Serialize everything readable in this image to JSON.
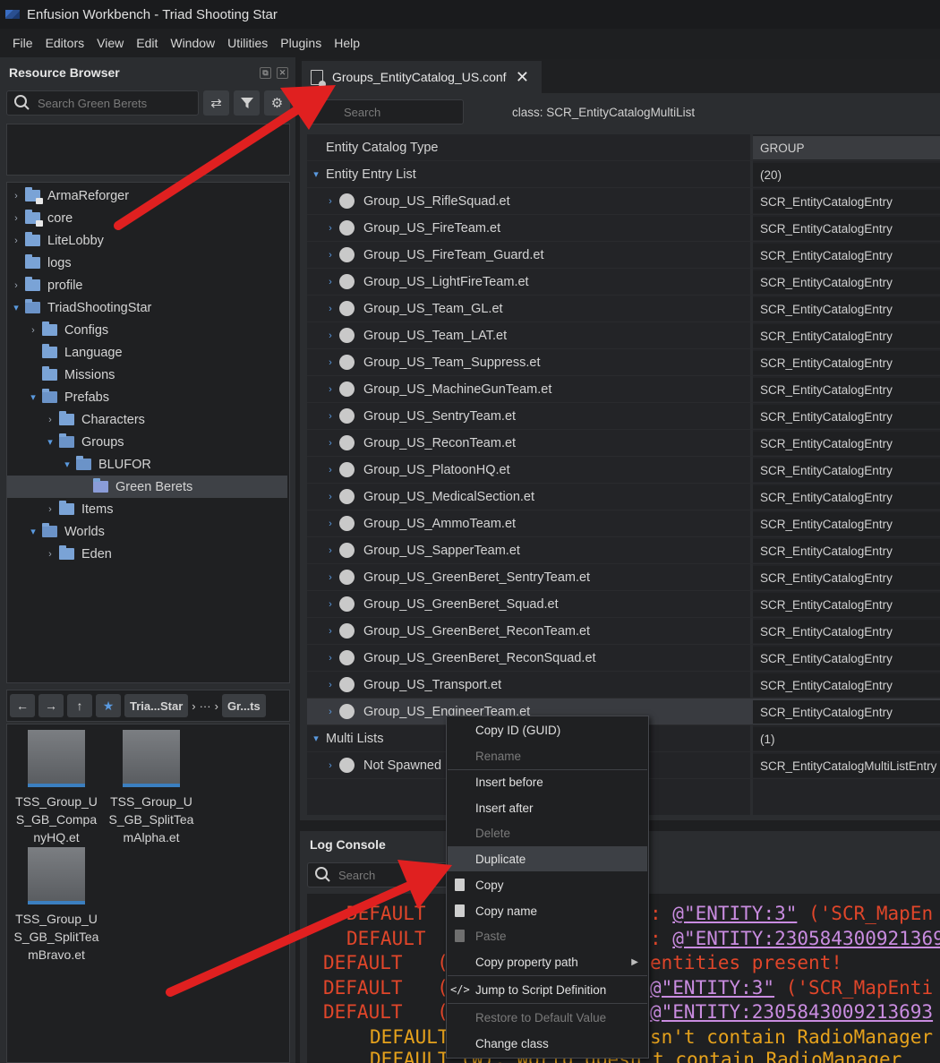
{
  "window": {
    "title": "Enfusion Workbench - Triad Shooting Star"
  },
  "menu": [
    "File",
    "Editors",
    "View",
    "Edit",
    "Window",
    "Utilities",
    "Plugins",
    "Help"
  ],
  "resource_browser": {
    "title": "Resource Browser",
    "search_placeholder": "Search Green Berets",
    "tree": [
      {
        "label": "ArmaReforger",
        "expandable": true,
        "locked": true,
        "depth": 0
      },
      {
        "label": "core",
        "expandable": true,
        "locked": true,
        "depth": 0
      },
      {
        "label": "LiteLobby",
        "expandable": true,
        "depth": 0
      },
      {
        "label": "logs",
        "expandable": false,
        "depth": 0
      },
      {
        "label": "profile",
        "expandable": true,
        "depth": 0
      },
      {
        "label": "TriadShootingStar",
        "expanded": true,
        "depth": 0
      },
      {
        "label": "Configs",
        "expandable": true,
        "depth": 1
      },
      {
        "label": "Language",
        "expandable": false,
        "depth": 1
      },
      {
        "label": "Missions",
        "expandable": false,
        "depth": 1
      },
      {
        "label": "Prefabs",
        "expanded": true,
        "depth": 1
      },
      {
        "label": "Characters",
        "expandable": true,
        "depth": 2
      },
      {
        "label": "Groups",
        "expanded": true,
        "depth": 2
      },
      {
        "label": "BLUFOR",
        "expanded": true,
        "depth": 3
      },
      {
        "label": "Green Berets",
        "selected": true,
        "depth": 4
      },
      {
        "label": "Items",
        "expandable": true,
        "depth": 2
      },
      {
        "label": "Worlds",
        "expanded": true,
        "depth": 1
      },
      {
        "label": "Eden",
        "expandable": true,
        "depth": 2
      }
    ],
    "nav": {
      "crumb1": "Tria...Star",
      "ellipsis": "···",
      "crumb2": "Gr...ts"
    },
    "files": [
      "TSS_Group_US_GB_CompanyHQ.et",
      "TSS_Group_US_GB_SplitTeamAlpha.et",
      "TSS_Group_US_GB_SplitTeamBravo.et"
    ],
    "file_lines": [
      [
        "TSS_Group_U",
        "S_GB_Compa",
        "nyHQ.et"
      ],
      [
        "TSS_Group_U",
        "S_GB_SplitTea",
        "mAlpha.et"
      ],
      [
        "TSS_Group_U",
        "S_GB_SplitTea",
        "mBravo.et"
      ]
    ]
  },
  "editor": {
    "tab_label": "Groups_EntityCatalog_US.conf",
    "search_placeholder": "Search",
    "class_label": "class: SCR_EntityCatalogMultiList",
    "catalog_type_label": "Entity Catalog Type",
    "catalog_type_value": "GROUP",
    "entry_list_label": "Entity Entry List",
    "entry_list_count": "(20)",
    "entries": [
      "Group_US_RifleSquad.et",
      "Group_US_FireTeam.et",
      "Group_US_FireTeam_Guard.et",
      "Group_US_LightFireTeam.et",
      "Group_US_Team_GL.et",
      "Group_US_Team_LAT.et",
      "Group_US_Team_Suppress.et",
      "Group_US_MachineGunTeam.et",
      "Group_US_SentryTeam.et",
      "Group_US_ReconTeam.et",
      "Group_US_PlatoonHQ.et",
      "Group_US_MedicalSection.et",
      "Group_US_AmmoTeam.et",
      "Group_US_SapperTeam.et",
      "Group_US_GreenBeret_SentryTeam.et",
      "Group_US_GreenBeret_Squad.et",
      "Group_US_GreenBeret_ReconTeam.et",
      "Group_US_GreenBeret_ReconSquad.et",
      "Group_US_Transport.et",
      "Group_US_EngineerTeam.et"
    ],
    "entry_class": "SCR_EntityCatalogEntry",
    "multi_lists_label": "Multi Lists",
    "multi_lists_count": "(1)",
    "not_spawned_label": "Not Spawned",
    "not_spawned_class": "SCR_EntityCatalogMultiListEntry"
  },
  "log_console": {
    "title": "Log Console",
    "search_placeholder": "Search",
    "lines": [
      {
        "a": "DEFAULT",
        "b": ": ",
        "c": "@\"ENTITY:3\"",
        "d": " ('SCR_MapEn"
      },
      {
        "a": "DEFAULT",
        "b": ": ",
        "c": "@\"ENTITY:230584300921369",
        "d": ""
      },
      {
        "a": "DEFAULT",
        "b": "(",
        "c": "",
        "d": "entities present!"
      },
      {
        "a": "DEFAULT",
        "b": "(",
        "c": "@\"ENTITY:3\"",
        "d": " ('SCR_MapEnti"
      },
      {
        "a": "DEFAULT",
        "b": "(",
        "c": "@\"ENTITY:2305843009213693",
        "d": ""
      },
      {
        "a": "DEFAULT",
        "b": "",
        "c": "",
        "d": "sn't contain RadioManager"
      },
      {
        "a": "DEFAULT",
        "b": "(W): World doesn't contain RadioManager",
        "c": "",
        "d": ""
      }
    ]
  },
  "context_menu": {
    "items": [
      {
        "label": "Copy ID (GUID)",
        "disabled": false
      },
      {
        "label": "Rename",
        "disabled": true
      },
      {
        "label": "Insert before",
        "disabled": false
      },
      {
        "label": "Insert after",
        "disabled": false
      },
      {
        "label": "Delete",
        "disabled": true
      },
      {
        "label": "Duplicate",
        "disabled": false,
        "hover": true
      },
      {
        "label": "Copy",
        "disabled": false,
        "icon": "clipboard-icon"
      },
      {
        "label": "Copy name",
        "disabled": false,
        "icon": "clipboard-icon"
      },
      {
        "label": "Paste",
        "disabled": true,
        "icon": "paste-icon"
      },
      {
        "label": "Copy property path",
        "disabled": false,
        "submenu": true
      },
      {
        "label": "Jump to Script Definition",
        "disabled": false,
        "icon": "code-icon"
      },
      {
        "label": "Restore to Default Value",
        "disabled": true
      },
      {
        "label": "Change class",
        "disabled": false
      }
    ]
  },
  "colors": {
    "accent": "#3b7fc0",
    "annotation_arrow": "#e02020",
    "log_red": "#e0462a",
    "log_orange": "#e6a21c",
    "log_link": "#c98ce0"
  }
}
